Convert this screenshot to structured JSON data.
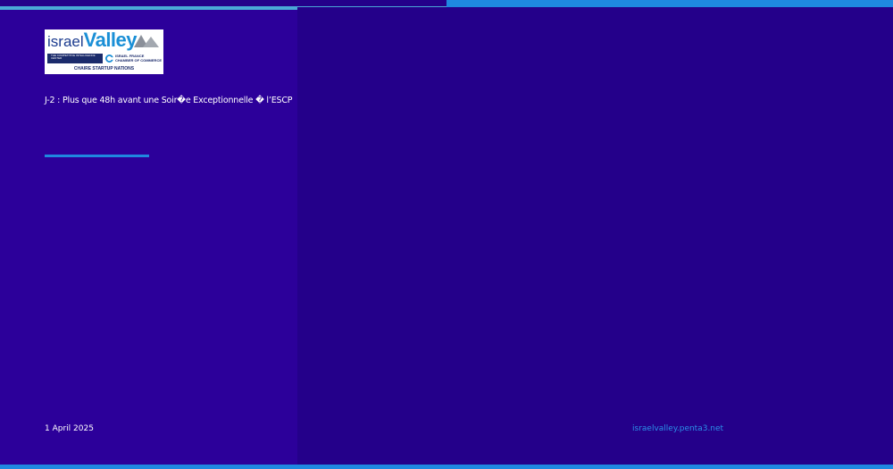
{
  "logo": {
    "word_israel": "israel",
    "word_valley": "Valley",
    "band_text": "THE COMPETITIVE INTELLIGENCE CENTER",
    "ccif_text": "ISRAEL FRANCE\nCHAMBER OF COMMERCE",
    "caption": "CHAIRE STARTUP NATIONS"
  },
  "article": {
    "headline": "J-2 : Plus que 48h avant une Soir�e Exceptionnelle � l’ESCP",
    "date": "1 April 2025"
  },
  "footer": {
    "site": "israelvalley.penta3.net"
  },
  "colors": {
    "background": "#24008a",
    "left_panel": "#2c009a",
    "accent": "#1f88e0"
  }
}
